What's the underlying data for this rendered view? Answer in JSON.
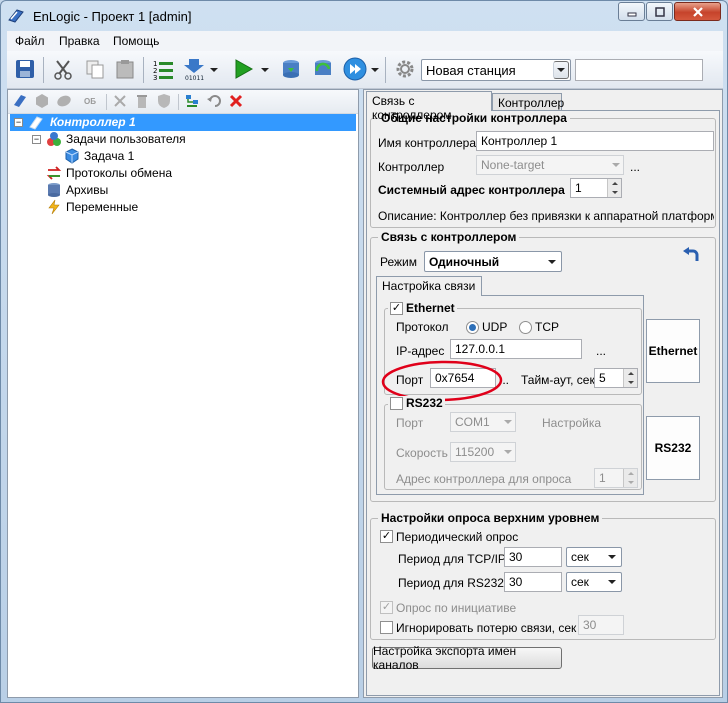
{
  "window": {
    "title": "EnLogic - Проект 1 [admin]"
  },
  "menu": {
    "items": [
      "Файл",
      "Правка",
      "Помощь"
    ]
  },
  "toolbar": {
    "station_combo": "Новая станция",
    "search_value": ""
  },
  "left_toolbar": {
    "ob_label": "ОБ"
  },
  "tree": {
    "root": "Контроллер 1",
    "user_tasks": "Задачи пользователя",
    "task1": "Задача 1",
    "protocols": "Протоколы обмена",
    "archives": "Архивы",
    "variables": "Переменные"
  },
  "tabs": [
    "Связь с контроллером",
    "Контроллер"
  ],
  "general": {
    "title": "Общие настройки контроллера",
    "name_label": "Имя контроллера",
    "name_value": "Контроллер 1",
    "controller_label": "Контроллер",
    "controller_value": "None-target",
    "sysaddr_label": "Системный адрес контроллера",
    "sysaddr_value": "1",
    "description": "Описание: Контроллер без привязки к аппаратной платформе (д."
  },
  "connection": {
    "title": "Связь с контроллером",
    "mode_label": "Режим",
    "mode_value": "Одиночный",
    "subtab": "Настройка связи",
    "ethernet": {
      "label": "Ethernet",
      "checked": true,
      "protocol_label": "Протокол",
      "udp": "UDP",
      "tcp": "TCP",
      "ip_label": "IP-адрес",
      "ip_value": "127.0.0.1",
      "port_label": "Порт",
      "port_value": "0x7654",
      "timeout_label": "Тайм-аут, сек",
      "timeout_value": "5"
    },
    "rs232": {
      "label": "RS232",
      "checked": false,
      "port_label": "Порт",
      "port_value": "COM1",
      "settings_label": "Настройка",
      "speed_label": "Скорость",
      "speed_value": "115200",
      "addr_label": "Адрес контроллера для опроса",
      "addr_value": "1"
    },
    "side_buttons": [
      "Ethernet",
      "RS232"
    ]
  },
  "polling": {
    "title": "Настройки опроса верхним уровнем",
    "periodic_label": "Периодический опрос",
    "periodic_checked": true,
    "tcp_label": "Период для TCP/IP",
    "tcp_value": "30",
    "tcp_unit": "сек",
    "rs_label": "Период для RS232",
    "rs_value": "30",
    "rs_unit": "сек",
    "initiative_label": "Опрос по инициативе",
    "initiative_checked": true,
    "ignore_label": "Игнорировать потерю связи, сек",
    "ignore_checked": false,
    "ignore_value": "30"
  },
  "export_button": "Настройка экспорта имен каналов",
  "colors": {
    "selection": "#3399ff",
    "highlight_ellipse": "#e0001a",
    "titlebar": "#c5d7ea"
  }
}
